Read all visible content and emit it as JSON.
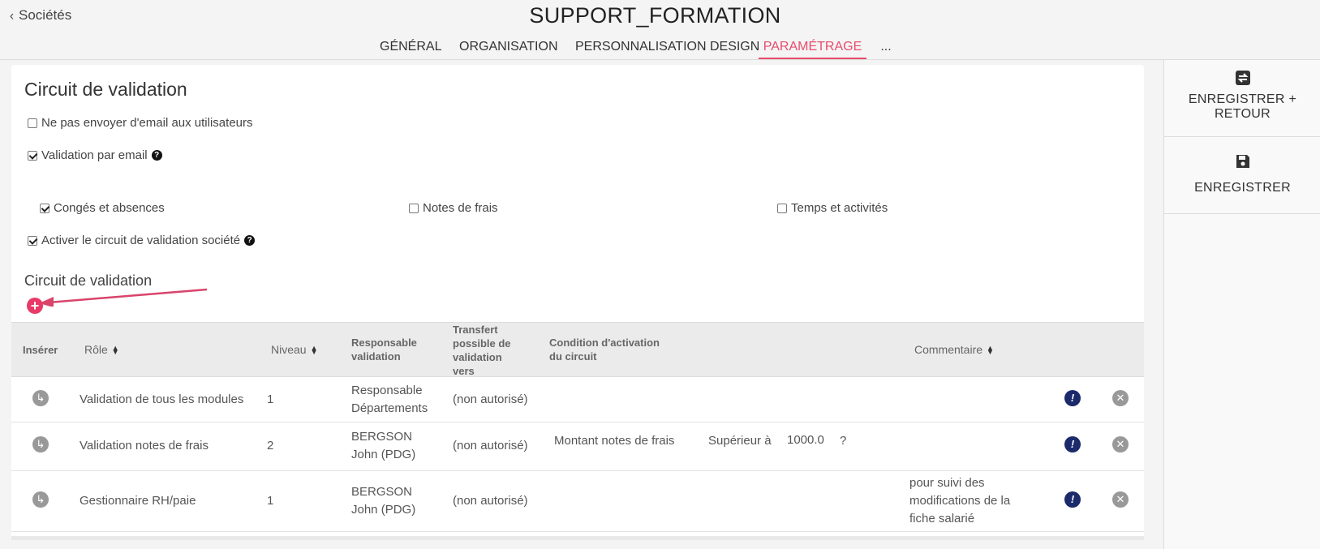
{
  "header": {
    "back_label": "Sociétés",
    "title": "SUPPORT_FORMATION",
    "tabs": [
      "GÉNÉRAL",
      "ORGANISATION",
      "PERSONNALISATION DESIGN",
      "PARAMÉTRAGE",
      "..."
    ],
    "active_tab": "PARAMÉTRAGE"
  },
  "section": {
    "title": "Circuit de validation",
    "opt_no_email": "Ne pas envoyer d'email aux utilisateurs",
    "opt_validation_email": "Validation par email",
    "opt_conges": "Congés et absences",
    "opt_notes": "Notes de frais",
    "opt_temps": "Temps et activités",
    "opt_activer": "Activer le circuit de validation société",
    "subtitle": "Circuit de validation"
  },
  "table": {
    "headers": {
      "inserer": "Insérer",
      "role": "Rôle",
      "niveau": "Niveau",
      "responsable": "Responsable validation",
      "transfert": "Transfert possible de validation vers",
      "condition": "Condition d'activation du circuit",
      "commentaire": "Commentaire"
    },
    "rows": [
      {
        "role": "Validation de tous les modules",
        "niveau": "1",
        "responsable": "Responsable Départements",
        "transfert": "(non autorisé)",
        "cond_field": "",
        "cond_op": "",
        "cond_value": "",
        "cond_help": "",
        "commentaire": ""
      },
      {
        "role": "Validation notes de frais",
        "niveau": "2",
        "responsable": "BERGSON John (PDG)",
        "transfert": "(non autorisé)",
        "cond_field": "Montant notes de frais",
        "cond_op": "Supérieur à",
        "cond_value": "1000.0",
        "cond_help": "?",
        "commentaire": ""
      },
      {
        "role": "Gestionnaire RH/paie",
        "niveau": "1",
        "responsable": "BERGSON John (PDG)",
        "transfert": "(non autorisé)",
        "cond_field": "",
        "cond_op": "",
        "cond_value": "",
        "cond_help": "",
        "commentaire": "pour suivi des modifications de la fiche salarié"
      }
    ]
  },
  "sidebar": {
    "save_return_label": "ENREGISTRER + RETOUR",
    "save_label": "ENREGISTRER"
  },
  "colors": {
    "accent": "#e84c6d",
    "add_button": "#e83a68",
    "edit_icon": "#1a2a6a"
  },
  "icons": {
    "back": "chevron-left-icon",
    "add": "plus-circle-icon",
    "insert": "insert-arrow-icon",
    "edit": "edit-circle-icon",
    "delete": "close-circle-icon",
    "save_return": "save-return-icon",
    "save": "floppy-disk-icon",
    "help": "question-circle-icon"
  }
}
